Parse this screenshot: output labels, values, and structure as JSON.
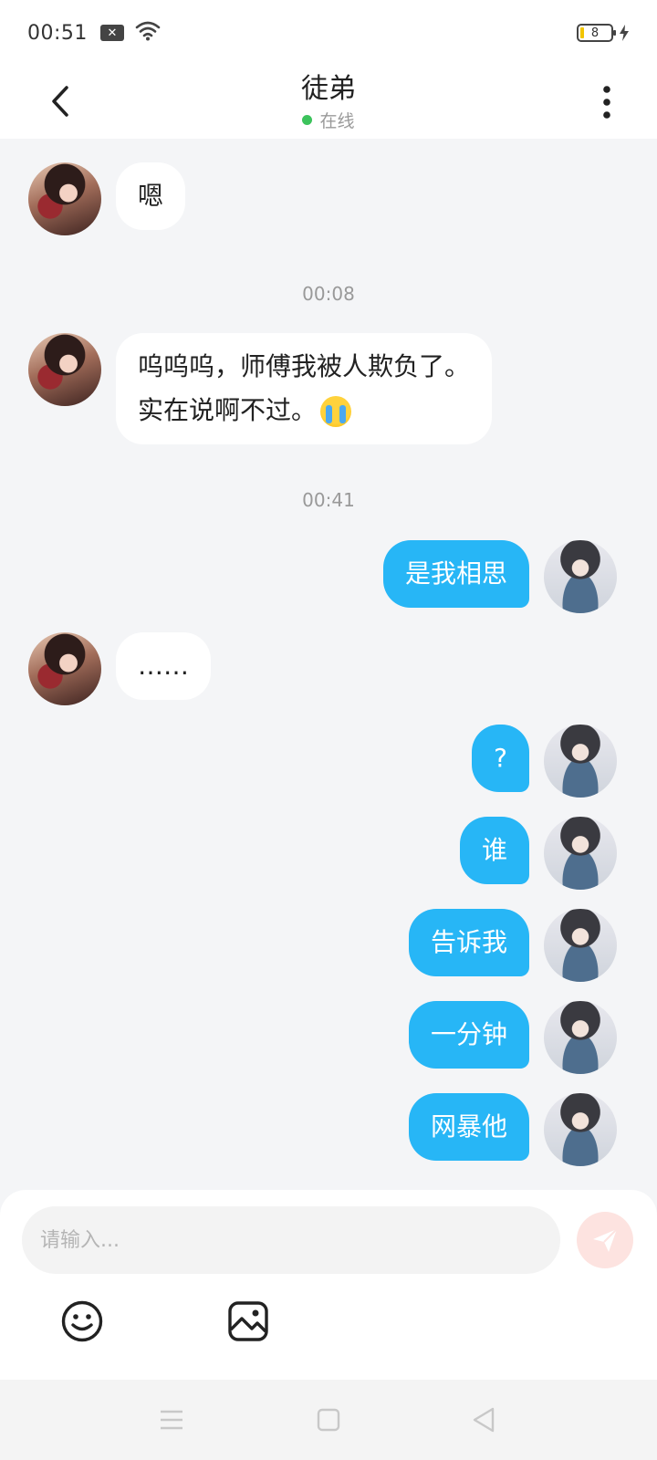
{
  "status_bar": {
    "time": "00:51",
    "battery_level": "8",
    "icons": [
      "notification-x-icon",
      "wifi-icon",
      "battery-icon",
      "charging-icon"
    ]
  },
  "header": {
    "title": "徒弟",
    "status": "在线",
    "status_color": "#3cc35c"
  },
  "messages": [
    {
      "from": "friend",
      "type": "text",
      "text": "嗯"
    },
    {
      "type": "timestamp",
      "text": "00:08"
    },
    {
      "from": "friend",
      "type": "text",
      "lines": [
        "呜呜呜，师傅我被人欺负了。",
        "实在说啊不过。"
      ],
      "emoji": "loudly-crying-face-emoji"
    },
    {
      "type": "timestamp",
      "text": "00:41"
    },
    {
      "from": "self",
      "type": "text",
      "text": "是我相思"
    },
    {
      "from": "friend",
      "type": "text",
      "text": "……"
    },
    {
      "from": "self",
      "type": "text",
      "text": "?"
    },
    {
      "from": "self",
      "type": "text",
      "text": "谁"
    },
    {
      "from": "self",
      "type": "text",
      "text": "告诉我"
    },
    {
      "from": "self",
      "type": "text",
      "text": "一分钟"
    },
    {
      "from": "self",
      "type": "text",
      "text": "网暴他"
    }
  ],
  "input": {
    "placeholder": "请输入...",
    "value": ""
  },
  "colors": {
    "outgoing_bubble": "#27b6f6",
    "incoming_bubble": "#ffffff",
    "background": "#f4f5f7",
    "send_button": "#fde3e0"
  }
}
